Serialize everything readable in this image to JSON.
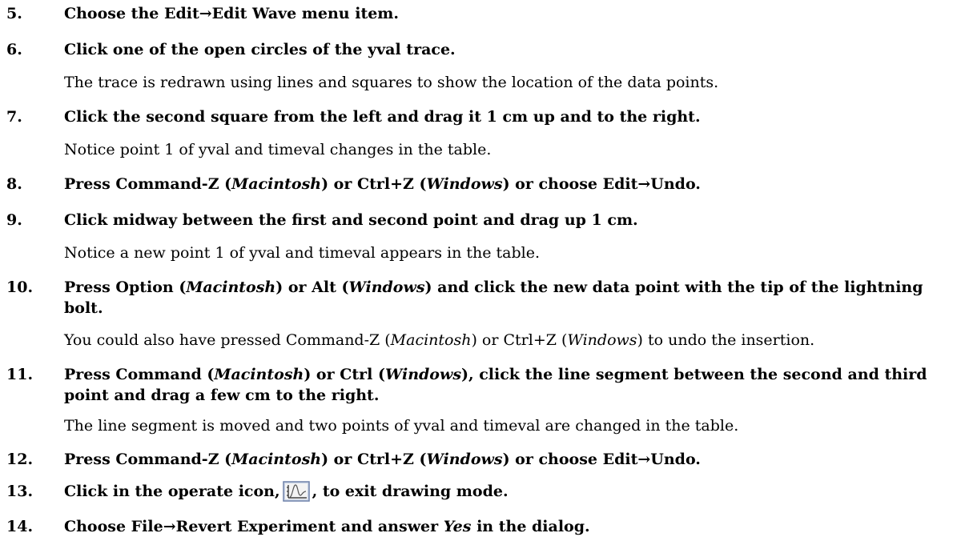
{
  "steps": [
    {
      "num": "5.",
      "parts": [
        "Choose the Edit",
        "→",
        "Edit Wave menu item."
      ]
    },
    {
      "num": "6.",
      "text": "Click one of the open circles of the yval trace.",
      "note": "The trace is redrawn using lines and squares to show the location of the data points."
    },
    {
      "num": "7.",
      "text": "Click the second square from the left and drag it 1 cm up and to the right.",
      "note": "Notice point 1 of yval and timeval changes in the table."
    },
    {
      "num": "8.",
      "parts": [
        "Press Command-Z (",
        "Macintosh",
        ") or Ctrl+Z (",
        "Windows",
        ") or choose Edit",
        "→",
        "Undo."
      ]
    },
    {
      "num": "9.",
      "text": "Click midway between the first and second point and drag up 1 cm.",
      "note": "Notice a new point 1 of yval and timeval appears in the table."
    },
    {
      "num": "10.",
      "parts": [
        "Press Option (",
        "Macintosh",
        ") or Alt (",
        "Windows",
        ") and click the new data point with the tip of the lightning bolt."
      ],
      "note_parts": [
        "You could also have pressed Command-Z (",
        "Macintosh",
        ") or Ctrl+Z (",
        "Windows",
        ") to undo the insertion."
      ]
    },
    {
      "num": "11.",
      "parts": [
        "Press Command (",
        "Macintosh",
        ") or Ctrl (",
        "Windows",
        "), click the line segment between the second and third point and drag a few cm to the right."
      ],
      "note": "The line segment is moved and two points of yval and timeval are changed in the table."
    },
    {
      "num": "12.",
      "parts": [
        "Press Command-Z (",
        "Macintosh",
        ") or Ctrl+Z (",
        "Windows",
        ") or choose Edit",
        "→",
        "Undo."
      ]
    },
    {
      "num": "13.",
      "parts": [
        "Click in the operate icon,",
        ", to exit drawing mode."
      ]
    },
    {
      "num": "14.",
      "parts": [
        "Choose File",
        "→",
        "Revert Experiment and answer ",
        "Yes",
        " in the dialog."
      ]
    }
  ],
  "icons": {
    "operate": "operate-mode-icon"
  }
}
